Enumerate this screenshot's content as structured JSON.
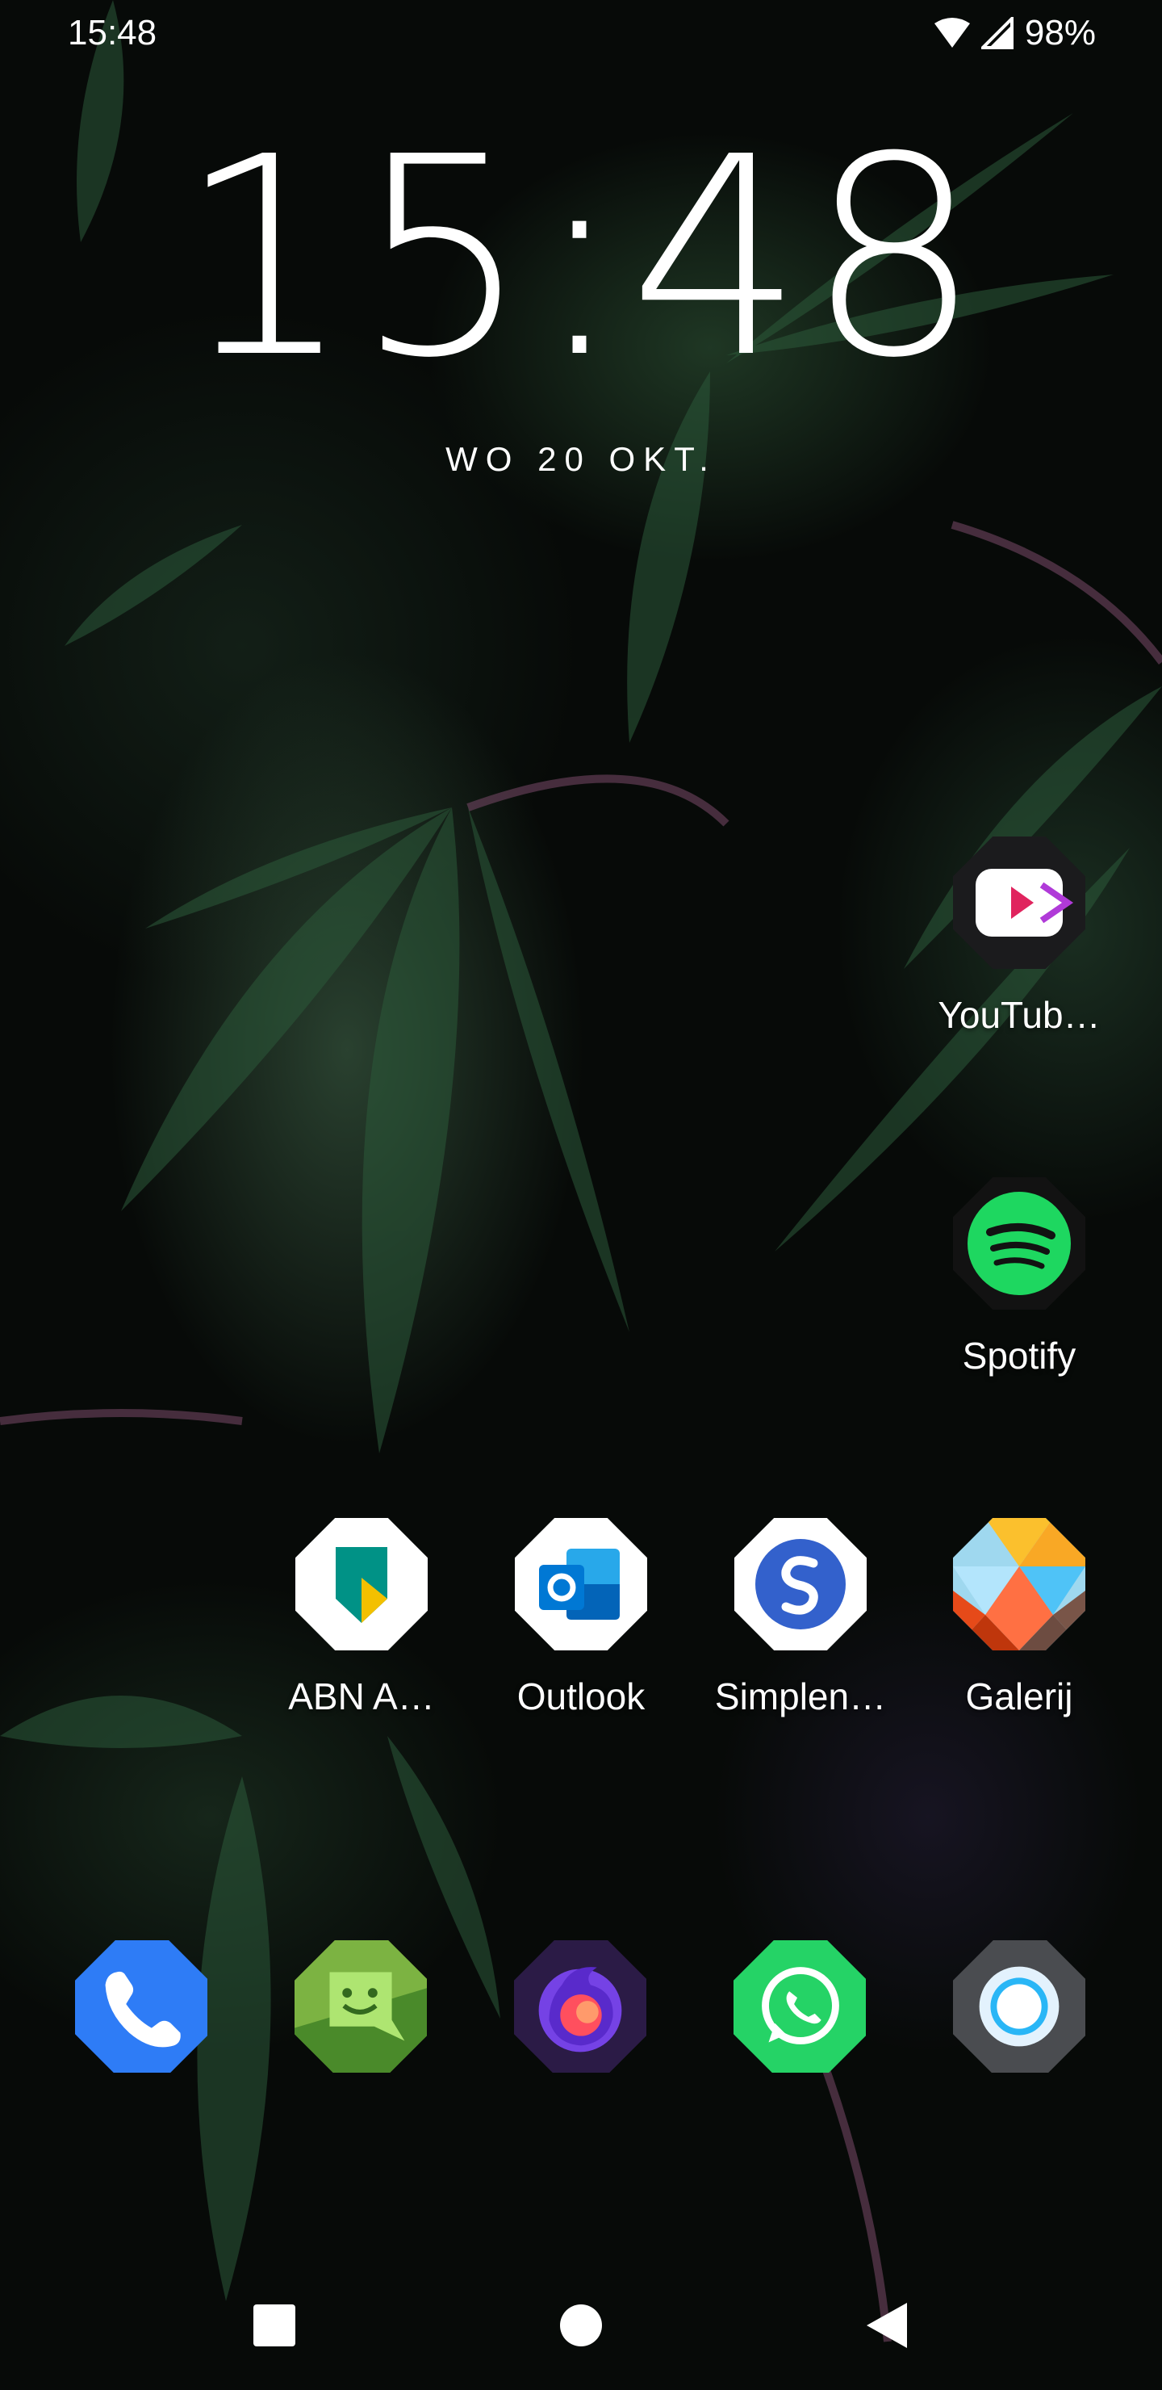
{
  "status_bar": {
    "time": "15:48",
    "battery": "98%"
  },
  "lock_clock": {
    "time": "15:48",
    "date": "WO 20 OKT."
  },
  "apps": {
    "youtube_vanced": {
      "label": "YouTub…"
    },
    "spotify": {
      "label": "Spotify"
    },
    "abn_amro": {
      "label": "ABN A…"
    },
    "outlook": {
      "label": "Outlook"
    },
    "simplenote": {
      "label": "Simplen…"
    },
    "galerij": {
      "label": "Galerij"
    }
  },
  "dock": [
    "phone",
    "messages",
    "firefox-focus",
    "whatsapp",
    "camera"
  ],
  "colors": {
    "spotify_green": "#1ed760",
    "whatsapp_green": "#25d366",
    "phone_blue": "#2e7cf6",
    "messages_green": "#7cb342",
    "simplenote_blue": "#3361cc"
  }
}
